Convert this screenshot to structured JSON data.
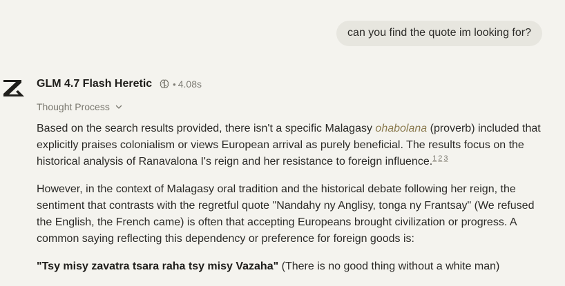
{
  "user_message": "can you find the quote im looking for?",
  "assistant": {
    "model_name": "GLM 4.7 Flash Heretic",
    "separator": "•",
    "time": "4.08s",
    "thought_label": "Thought Process",
    "p1": {
      "before": "Based on the search results provided, there isn't a specific Malagasy ",
      "term": "ohabolana",
      "after": " (proverb) included that explicitly praises colonialism or views European arrival as purely beneficial. The results focus on the historical analysis of Ranavalona I's reign and her resistance to foreign influence.",
      "citations": [
        "1",
        "2",
        "3"
      ]
    },
    "p2": "However, in the context of Malagasy oral tradition and the historical debate following her reign, the sentiment that contrasts with the regretful quote \"Nandahy ny Anglisy, tonga ny Frantsay\" (We refused the English, the French came) is often that accepting Europeans brought civilization or progress. A common saying reflecting this dependency or preference for foreign goods is:",
    "p3": {
      "quote": "\"Tsy misy zavatra tsara raha tsy misy Vazaha\"",
      "translation": " (There is no good thing without a white man)"
    }
  },
  "icons": {
    "logo": "z-logo-icon",
    "brain": "brain-icon",
    "chevron": "chevron-down-icon"
  },
  "colors": {
    "background": "#f4f3ee",
    "user_bubble": "#e7e6df",
    "term_accent": "#8a7a4e",
    "muted_text": "#7a786f"
  }
}
